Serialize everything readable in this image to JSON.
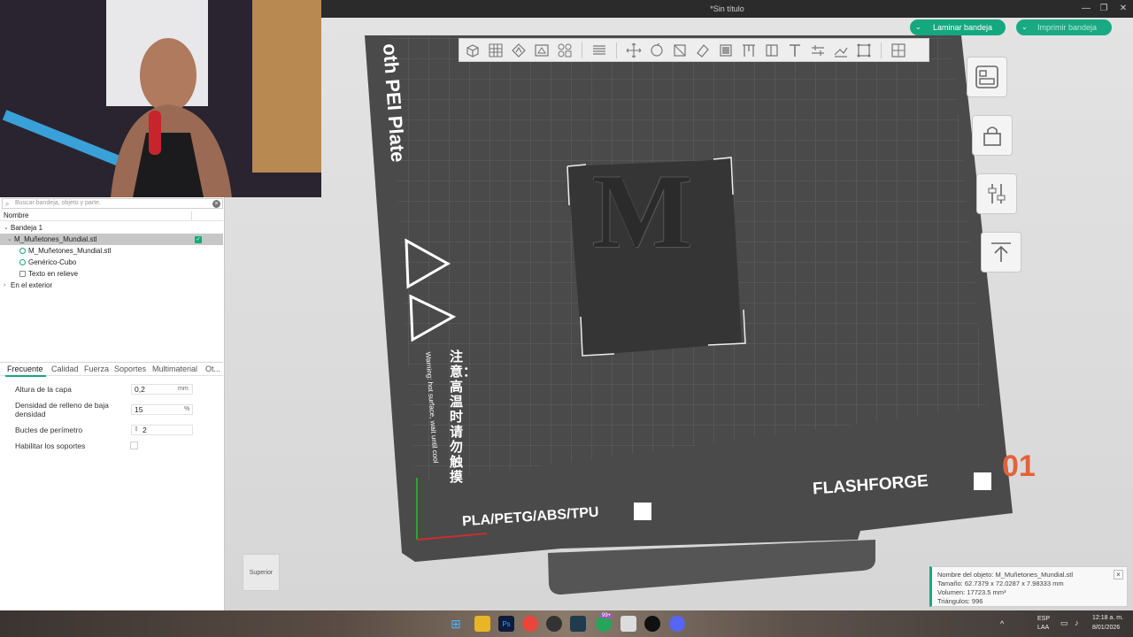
{
  "window": {
    "title": "*Sin título"
  },
  "actions": {
    "slice_label": "Laminar bandeja",
    "print_label": "Imprimir bandeja"
  },
  "search": {
    "placeholder": "Buscar bandeja, objeto y parte."
  },
  "objects_panel": {
    "column_name": "Nombre",
    "tree": [
      {
        "label": "Bandeja 1",
        "level": 0,
        "expanded": true
      },
      {
        "label": "M_Muñetones_Mundial.stl",
        "level": 1,
        "expanded": true,
        "selected": true,
        "visible": true
      },
      {
        "label": "M_Muñetones_Mundial.stl",
        "level": 2,
        "icon": "part-icon"
      },
      {
        "label": "Genérico-Cubo",
        "level": 2,
        "icon": "part-icon"
      },
      {
        "label": "Texto en relieve",
        "level": 2,
        "icon": "text-icon"
      },
      {
        "label": "En el exterior",
        "level": 0,
        "expanded": false
      }
    ]
  },
  "settings_tabs": [
    "Frecuente",
    "Calidad",
    "Fuerza",
    "Soportes",
    "Multimaterial",
    "Ot..."
  ],
  "settings": {
    "layer_height": {
      "label": "Altura de la capa",
      "value": "0,2",
      "unit": "mm"
    },
    "infill_density": {
      "label": "Densidad de relleno de baja densidad",
      "value": "15",
      "unit": "%"
    },
    "wall_loops": {
      "label": "Bucles de perímetro",
      "value": "2"
    },
    "enable_support": {
      "label": "Habilitar los soportes",
      "checked": false
    }
  },
  "plate": {
    "label_top": "oth PEI Plate",
    "label_filaments": "PLA/PETG/ABS/TPU",
    "brand": "FLASHFORGE",
    "plate_number": "01",
    "warning_cn": "注意：高温时请勿触摸",
    "warning_en": "Warning: hot surface, wait until cool",
    "model_letter": "M"
  },
  "view_cube": {
    "face": "Superior"
  },
  "object_info": {
    "name": "Nombre del objeto: M_Muñetones_Mundial.stl",
    "size": "Tamaño: 62.7379 x 72.0287 x 7.98333 mm",
    "volume": "Volumen: 17723.5 mm³",
    "triangles": "Triángulos: 996"
  },
  "taskbar": {
    "lang_top": "ESP",
    "lang_bottom": "LAA",
    "time": "12:18 a. m.",
    "date": "8/01/2026",
    "badge": "99+"
  },
  "colors": {
    "accent": "#15a87f",
    "plate": "#4a4a4a",
    "model": "#353535"
  }
}
